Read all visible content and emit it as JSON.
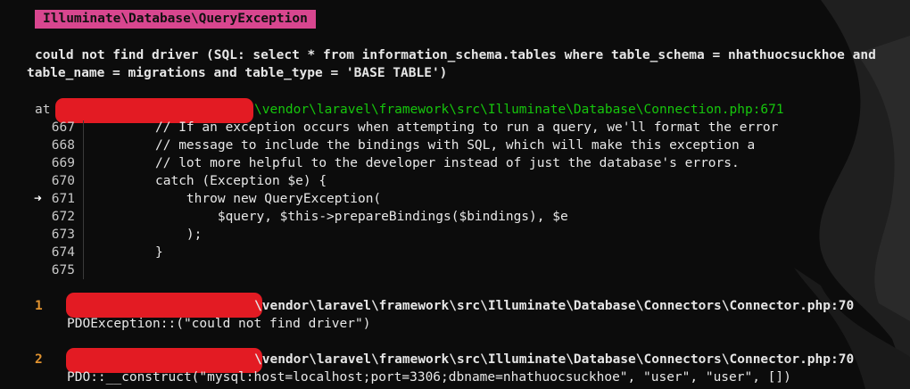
{
  "exception": {
    "class": "Illuminate\\Database\\QueryException",
    "message_line1": "could not find driver (SQL: select * from information_schema.tables where table_schema = nhathuocsuckhoe and",
    "message_line2": "table_name = migrations and table_type = 'BASE TABLE')"
  },
  "location": {
    "at_label": "at",
    "path": "\\vendor\\laravel\\framework\\src\\Illuminate\\Database\\Connection.php:671"
  },
  "code": {
    "arrow": "➜",
    "lines": [
      {
        "num": "667",
        "text": "// If an exception occurs when attempting to run a query, we'll format the error"
      },
      {
        "num": "668",
        "text": "// message to include the bindings with SQL, which will make this exception a"
      },
      {
        "num": "669",
        "text": "// lot more helpful to the developer instead of just the database's errors."
      },
      {
        "num": "670",
        "text": "catch (Exception $e) {"
      },
      {
        "num": "671",
        "text": "    throw new QueryException("
      },
      {
        "num": "672",
        "text": "        $query, $this->prepareBindings($bindings), $e"
      },
      {
        "num": "673",
        "text": "    );"
      },
      {
        "num": "674",
        "text": "}"
      },
      {
        "num": "675",
        "text": ""
      }
    ]
  },
  "frames": [
    {
      "num": "1",
      "path": "\\vendor\\laravel\\framework\\src\\Illuminate\\Database\\Connectors\\Connector.php:70",
      "call": "PDOException::(\"could not find driver\")"
    },
    {
      "num": "2",
      "path": "\\vendor\\laravel\\framework\\src\\Illuminate\\Database\\Connectors\\Connector.php:70",
      "call": "PDO::__construct(\"mysql:host=localhost;port=3306;dbname=nhathuocsuckhoe\", \"user\", \"user\", [])"
    }
  ],
  "colors": {
    "background": "#0c0c0c",
    "badge": "#d8468f",
    "path_green": "#16c60c",
    "frame_number": "#e0922f",
    "redaction": "#e31b23"
  }
}
